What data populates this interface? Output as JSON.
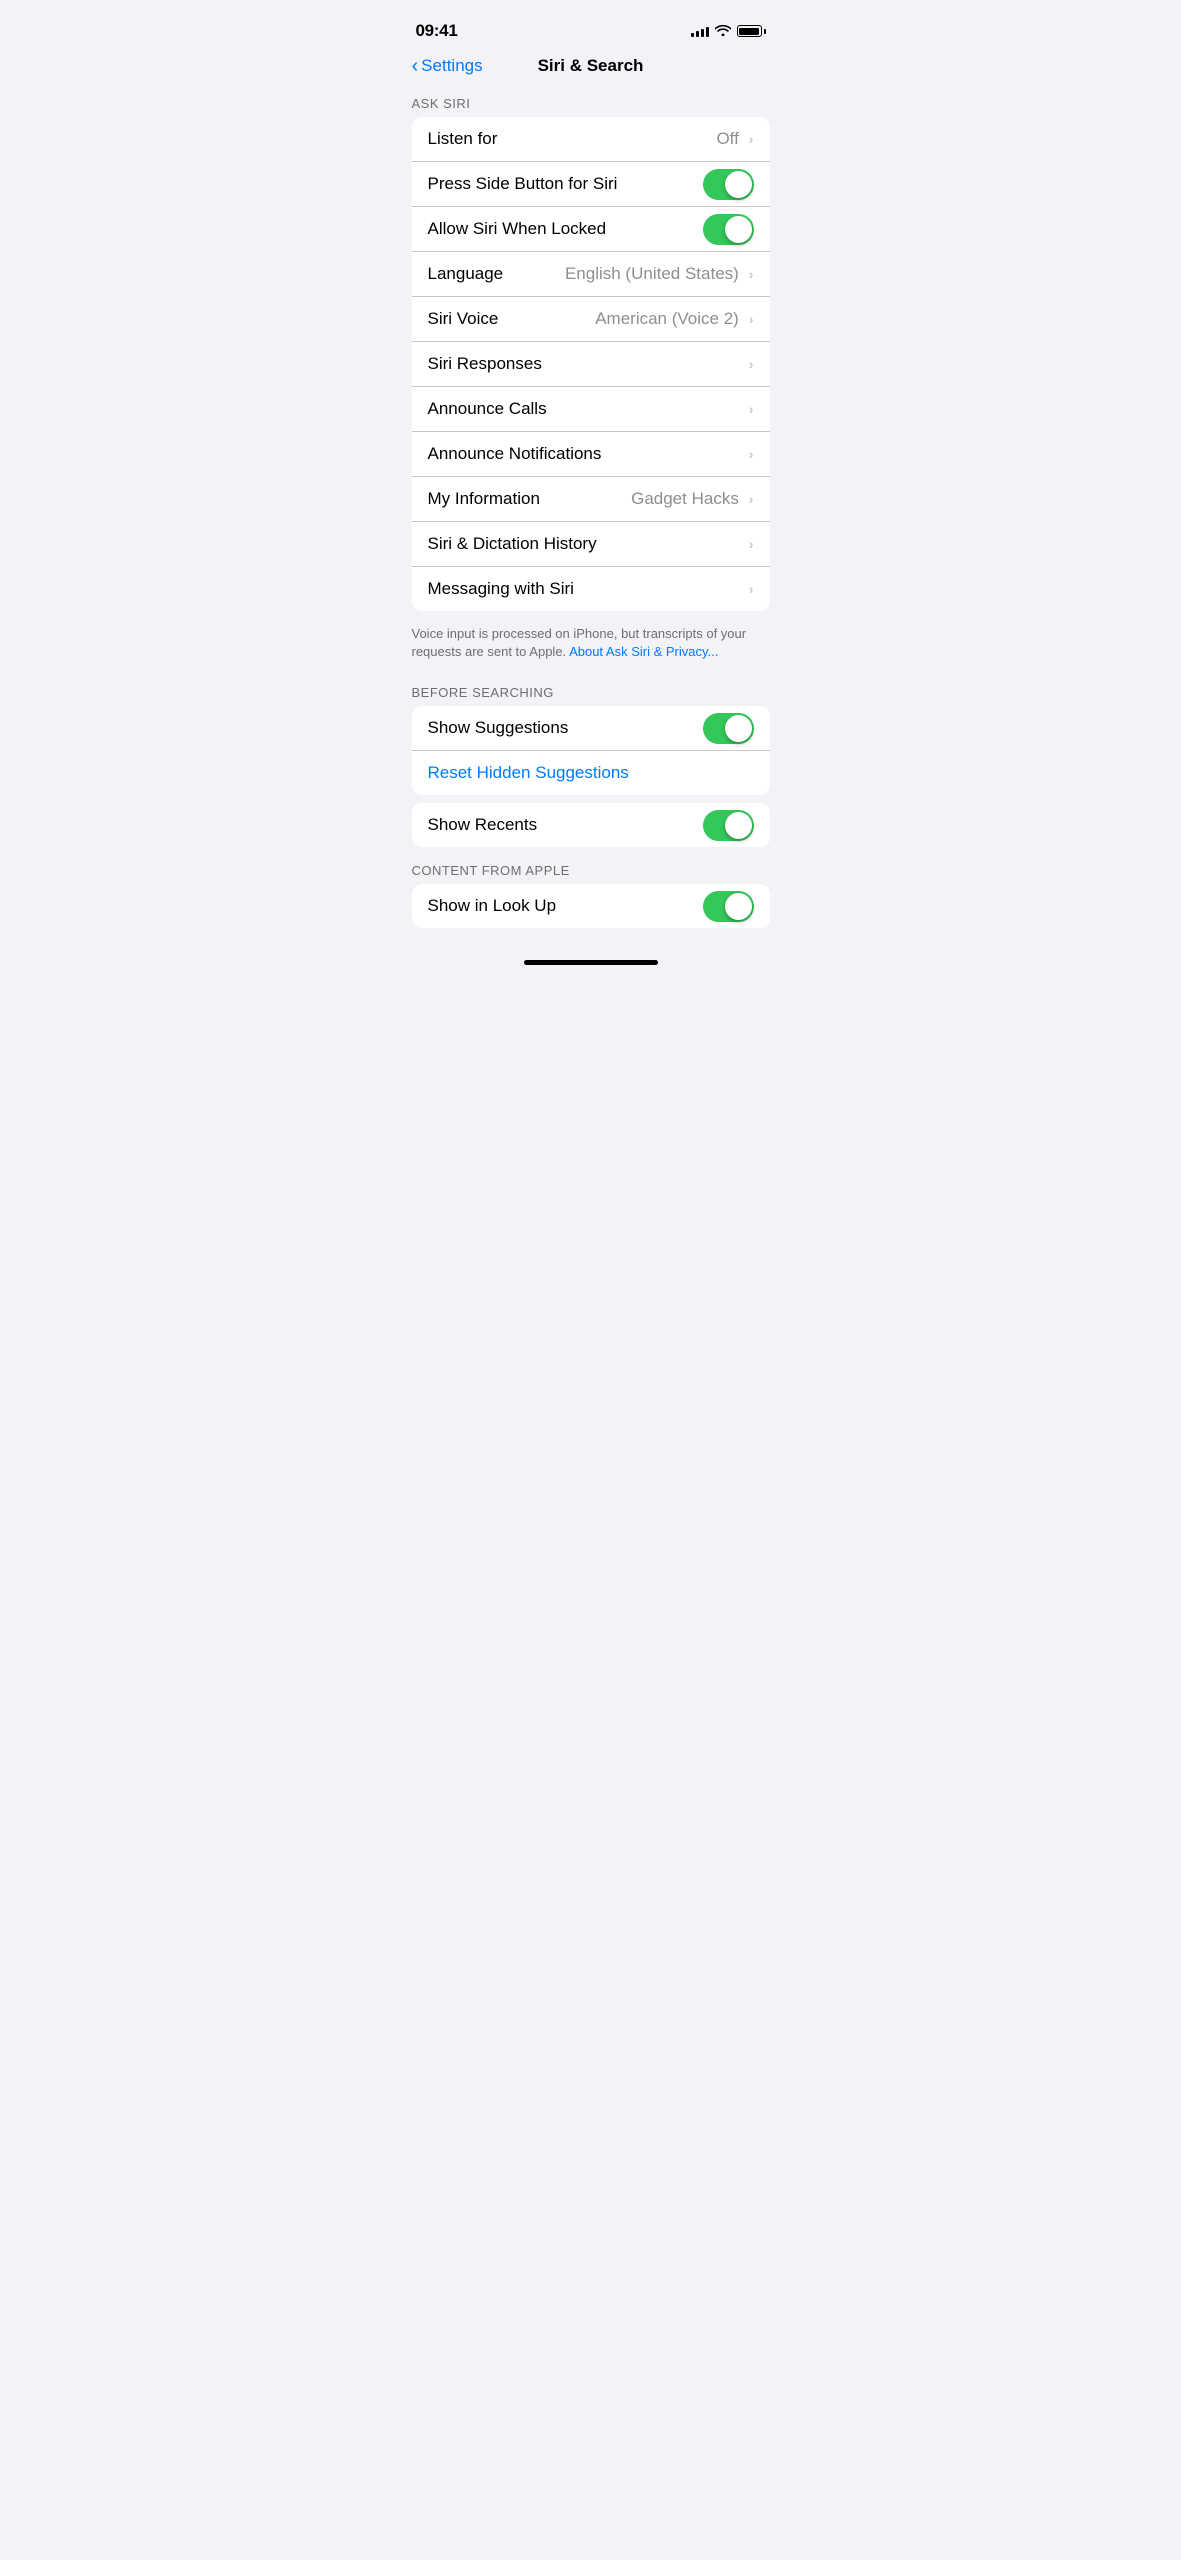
{
  "statusBar": {
    "time": "09:41",
    "signalBars": [
      4,
      6,
      8,
      10,
      12
    ],
    "batteryFull": true
  },
  "nav": {
    "backLabel": "Settings",
    "title": "Siri & Search"
  },
  "askSiriSection": {
    "header": "ASK SIRI",
    "rows": [
      {
        "label": "Listen for",
        "value": "Off",
        "type": "navigate"
      },
      {
        "label": "Press Side Button for Siri",
        "value": null,
        "type": "toggle",
        "enabled": true
      },
      {
        "label": "Allow Siri When Locked",
        "value": null,
        "type": "toggle",
        "enabled": true
      },
      {
        "label": "Language",
        "value": "English (United States)",
        "type": "navigate"
      },
      {
        "label": "Siri Voice",
        "value": "American (Voice 2)",
        "type": "navigate"
      },
      {
        "label": "Siri Responses",
        "value": null,
        "type": "navigate"
      },
      {
        "label": "Announce Calls",
        "value": null,
        "type": "navigate"
      },
      {
        "label": "Announce Notifications",
        "value": null,
        "type": "navigate"
      },
      {
        "label": "My Information",
        "value": "Gadget Hacks",
        "type": "navigate"
      },
      {
        "label": "Siri & Dictation History",
        "value": null,
        "type": "navigate"
      },
      {
        "label": "Messaging with Siri",
        "value": null,
        "type": "navigate"
      }
    ],
    "footer": {
      "text": "Voice input is processed on iPhone, but transcripts of your requests are sent to Apple. ",
      "linkText": "About Ask Siri & Privacy...",
      "linkHref": "#"
    }
  },
  "beforeSearchingSection": {
    "header": "BEFORE SEARCHING",
    "rows": [
      {
        "label": "Show Suggestions",
        "value": null,
        "type": "toggle",
        "enabled": true
      },
      {
        "label": "Reset Hidden Suggestions",
        "value": null,
        "type": "reset"
      },
      {
        "label": "Show Recents",
        "value": null,
        "type": "toggle",
        "enabled": true
      }
    ]
  },
  "contentFromAppleSection": {
    "header": "CONTENT FROM APPLE",
    "rows": [
      {
        "label": "Show in Look Up",
        "value": null,
        "type": "toggle",
        "enabled": true
      }
    ]
  },
  "homeIndicator": true
}
